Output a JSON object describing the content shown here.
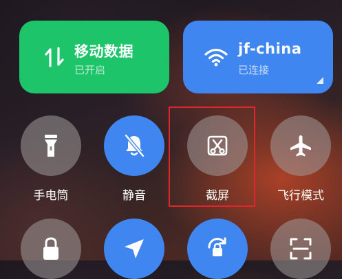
{
  "tiles": {
    "mobile_data": {
      "title": "移动数据",
      "status": "已开启",
      "color": "#1ec46a",
      "icon": "mobile-data-arrows-icon"
    },
    "wifi": {
      "title": "jf-china",
      "status": "已连接",
      "color": "#3f86f1",
      "icon": "wifi-icon"
    }
  },
  "toggles": [
    {
      "label": "手电筒",
      "icon": "flashlight-icon",
      "active": false
    },
    {
      "label": "静音",
      "icon": "bell-muted-icon",
      "active": true
    },
    {
      "label": "截屏",
      "icon": "screenshot-scissors-icon",
      "active": false,
      "highlighted": true
    },
    {
      "label": "飞行模式",
      "icon": "airplane-icon",
      "active": false
    }
  ],
  "toggles_row2": [
    {
      "icon": "lock-icon",
      "active": false
    },
    {
      "icon": "location-arrow-icon",
      "active": true
    },
    {
      "icon": "rotation-lock-icon",
      "active": true
    },
    {
      "icon": "scan-icon",
      "active": false
    }
  ],
  "colors": {
    "accent_blue": "#3f86f1",
    "accent_green": "#1ec46a",
    "highlight_red": "#e0262c"
  }
}
